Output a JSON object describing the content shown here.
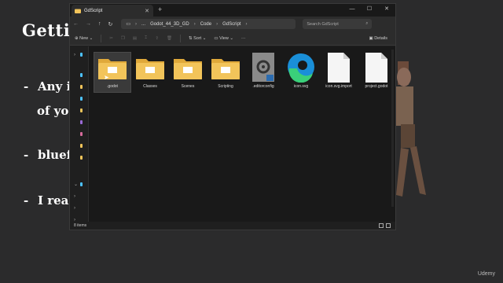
{
  "slide": {
    "title": "Getti",
    "bullets": [
      {
        "dash": "-",
        "text": "Any i"
      },
      {
        "dash": "",
        "text": "of yo"
      },
      {
        "dash": "-",
        "text": "bluef"
      },
      {
        "dash": "-",
        "text": "I real"
      }
    ],
    "watermark": "Udemy"
  },
  "explorer": {
    "tab_title": "GdScript",
    "address": {
      "breadcrumbs": [
        "...",
        "Godot_44_3D_GD",
        "Code",
        "GdScript"
      ]
    },
    "search": {
      "placeholder": "Search GdScript"
    },
    "toolbar": {
      "new_label": "New",
      "sort_label": "Sort",
      "view_label": "View",
      "more_label": "···",
      "details_label": "Details"
    },
    "items": [
      {
        "name": ".godot",
        "type": "folder",
        "selected": true
      },
      {
        "name": "Classes",
        "type": "folder",
        "selected": false
      },
      {
        "name": "Scenes",
        "type": "folder",
        "selected": false
      },
      {
        "name": "Scripting",
        "type": "folder",
        "selected": false
      },
      {
        "name": ".editorconfig",
        "type": "config-file",
        "selected": false
      },
      {
        "name": "icon.svg",
        "type": "edge-svg-file",
        "selected": false
      },
      {
        "name": "icon.svg.import",
        "type": "blank-file",
        "selected": false
      },
      {
        "name": "project.godot",
        "type": "blank-file",
        "selected": false
      }
    ],
    "status": {
      "count": "8 items"
    },
    "colors": {
      "folder": "#f2c45a",
      "accent": "#4cc2ff",
      "window_bg": "#1f1f1f"
    }
  }
}
